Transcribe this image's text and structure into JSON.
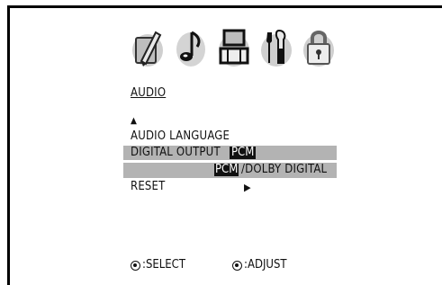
{
  "menu": {
    "title": "AUDIO",
    "icons": [
      "general-settings-icon",
      "audio-icon",
      "display-icon",
      "tools-icon",
      "lock-icon"
    ],
    "items": {
      "audio_language": "AUDIO LANGUAGE",
      "digital_output": "DIGITAL OUTPUT",
      "digital_output_value": "PCM",
      "digital_output_option_selected": "PCM",
      "digital_output_option_rest": "/DOLBY DIGITAL",
      "reset": "RESET"
    },
    "arrows": {
      "up": "▲",
      "right": "▶"
    }
  },
  "footer": {
    "select_hint": ":SELECT",
    "adjust_hint": ":ADJUST"
  },
  "colors": {
    "highlight": "#b3b3b3",
    "text": "#111111",
    "inverse_text": "#ffffff",
    "border": "#000000"
  }
}
